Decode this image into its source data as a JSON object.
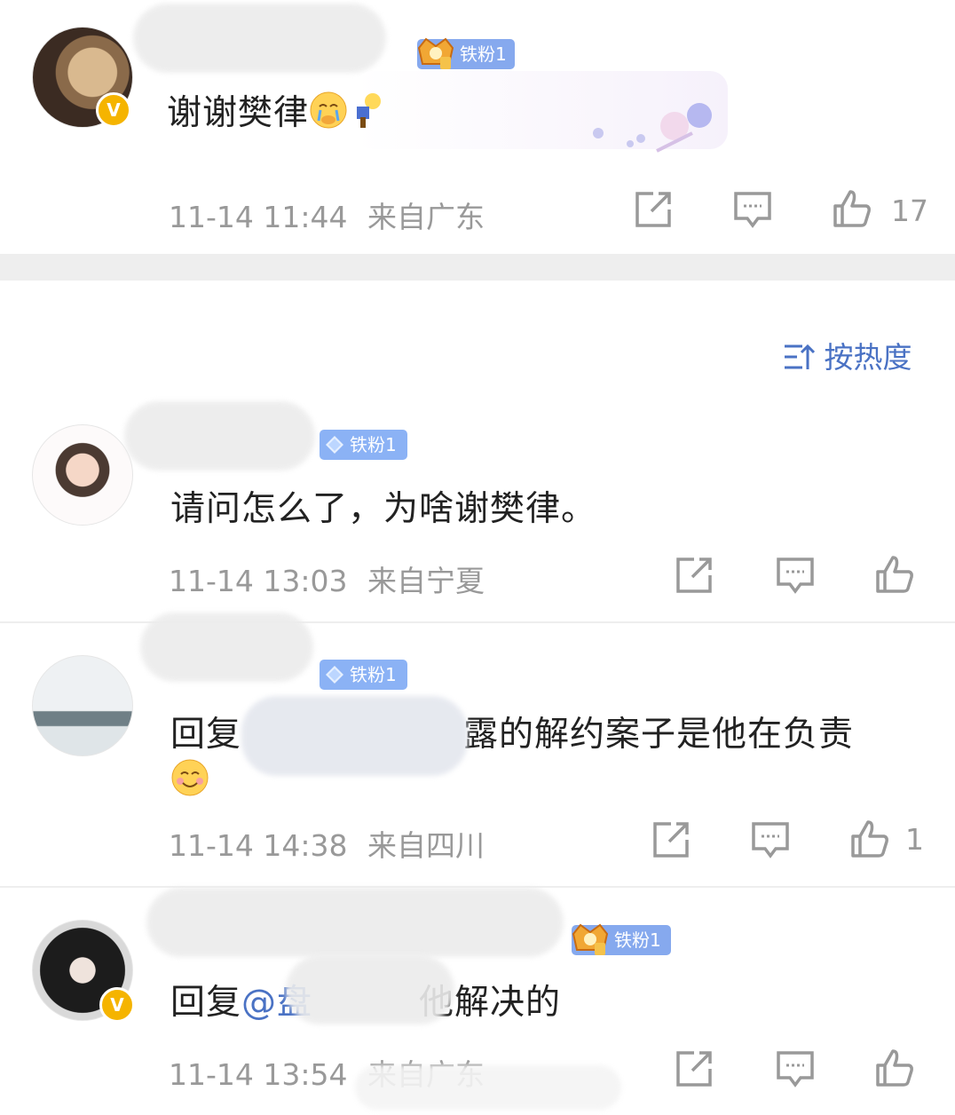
{
  "colors": {
    "accent": "#4a72c4",
    "badge_blue": "#8bb2f5",
    "vip_gold": "#f5b400",
    "meta_gray": "#999999",
    "divider": "#eeeeee"
  },
  "top_comment": {
    "badge": "铁粉1",
    "text": "谢谢樊律",
    "time": "11-14 11:44",
    "location": "来自广东",
    "likes": "17"
  },
  "sort": {
    "label": "按热度",
    "icon": "sort-icon"
  },
  "comments": [
    {
      "badge": "铁粉1",
      "text": "请问怎么了，为啥谢樊律。",
      "time": "11-14 13:03",
      "location": "来自宁夏",
      "likes": ""
    },
    {
      "badge": "铁粉1",
      "text_prefix": "回复",
      "text_suffix": "露的解约案子是他在负责",
      "time": "11-14 14:38",
      "location": "来自四川",
      "likes": "1"
    },
    {
      "badge": "铁粉1",
      "text_prefix": "回复",
      "text_mention": "@盘",
      "text_suffix": "他解决的",
      "time": "11-14 13:54",
      "location": "来自广东",
      "likes": ""
    }
  ]
}
